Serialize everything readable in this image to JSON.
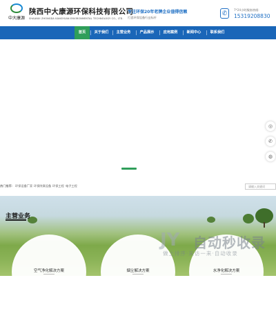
{
  "header": {
    "logo_text": "中大康源",
    "company_name": "陕西中大康源环保科技有限公司",
    "company_name_en": "SHAANXI ZHONGDA KANGYUAN ENVIRONMENTAL TECHNOLOGY CO., LTD.",
    "slogan_main": "专注环保20年老牌企业值得信赖",
    "slogan_sub": "打造环保设备行业标杆",
    "phone_label": "7*24小时服务热线:",
    "phone_number": "15319208830",
    "icon": "phone-icon"
  },
  "nav": {
    "items": [
      {
        "label": "首页",
        "active": true
      },
      {
        "label": "关于我们",
        "active": false
      },
      {
        "label": "主营业务",
        "active": false
      },
      {
        "label": "产品展示",
        "active": false
      },
      {
        "label": "应用案例",
        "active": false
      },
      {
        "label": "新闻中心",
        "active": false
      },
      {
        "label": "联系我们",
        "active": false
      }
    ],
    "bg_color": "#1a66b8",
    "active_color": "#2f9e5a"
  },
  "side_tools": [
    "chat-icon",
    "phone-icon",
    "wechat-icon"
  ],
  "hot_search": {
    "label": "热门推荐:",
    "items": [
      "环保设备厂家",
      "环保除臭设备",
      "环保工程",
      "电子工程"
    ],
    "search_placeholder": "请输入关键词"
  },
  "business": {
    "title": "主营业务",
    "cards": [
      {
        "label": "空气净化解决方案"
      },
      {
        "label": "烟尘解决方案"
      },
      {
        "label": "水净化解决方案"
      }
    ]
  },
  "watermark": {
    "logo": "JY",
    "main": "自动秒收录",
    "sub": "做上排序·来访一来·自动收录"
  }
}
